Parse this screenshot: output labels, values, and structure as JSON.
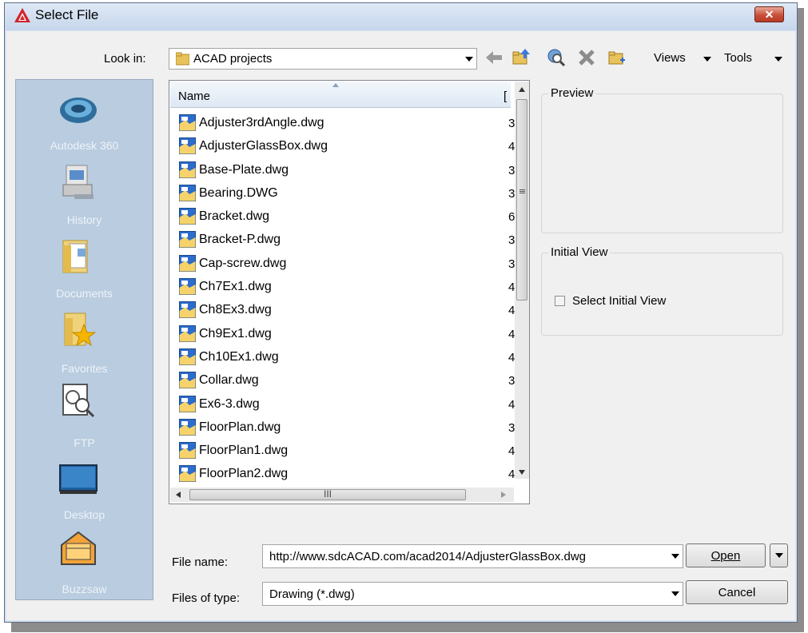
{
  "window": {
    "title": "Select File",
    "close_label": "✕"
  },
  "toolbar": {
    "look_in_label": "Look in:",
    "look_in_value": "ACAD projects",
    "views_label": "Views",
    "tools_label": "Tools"
  },
  "places": [
    {
      "label": "Autodesk 360",
      "icon": "autodesk-360-icon"
    },
    {
      "label": "History",
      "icon": "history-icon"
    },
    {
      "label": "Documents",
      "icon": "documents-icon"
    },
    {
      "label": "Favorites",
      "icon": "favorites-icon"
    },
    {
      "label": "FTP",
      "icon": "ftp-icon"
    },
    {
      "label": "Desktop",
      "icon": "desktop-icon"
    },
    {
      "label": "Buzzsaw",
      "icon": "buzzsaw-icon"
    }
  ],
  "file_list": {
    "column_name": "Name",
    "column_second": "[",
    "hscroll_grip": "III",
    "files": [
      {
        "name": "Adjuster3rdAngle.dwg",
        "partial": "3"
      },
      {
        "name": "AdjusterGlassBox.dwg",
        "partial": "4"
      },
      {
        "name": "Base-Plate.dwg",
        "partial": "3"
      },
      {
        "name": "Bearing.DWG",
        "partial": "3"
      },
      {
        "name": "Bracket.dwg",
        "partial": "6"
      },
      {
        "name": "Bracket-P.dwg",
        "partial": "3"
      },
      {
        "name": "Cap-screw.dwg",
        "partial": "3"
      },
      {
        "name": "Ch7Ex1.dwg",
        "partial": "4"
      },
      {
        "name": "Ch8Ex3.dwg",
        "partial": "4"
      },
      {
        "name": "Ch9Ex1.dwg",
        "partial": "4"
      },
      {
        "name": "Ch10Ex1.dwg",
        "partial": "4"
      },
      {
        "name": "Collar.dwg",
        "partial": "3"
      },
      {
        "name": "Ex6-3.dwg",
        "partial": "4"
      },
      {
        "name": "FloorPlan.dwg",
        "partial": "3"
      },
      {
        "name": "FloorPlan1.dwg",
        "partial": "4"
      },
      {
        "name": "FloorPlan2.dwg",
        "partial": "4"
      }
    ]
  },
  "preview": {
    "title": "Preview"
  },
  "initial_view": {
    "title": "Initial View",
    "checkbox_label": "Select Initial View",
    "checked": false
  },
  "file_name": {
    "label": "File name:",
    "value": "http://www.sdcACAD.com/acad2014/AdjusterGlassBox.dwg"
  },
  "file_type": {
    "label": "Files of type:",
    "value": "Drawing (*.dwg)"
  },
  "buttons": {
    "open": "Open",
    "cancel": "Cancel"
  },
  "colors": {
    "places_bg": "#b9cce0",
    "title_bar": "#d3e0f1",
    "close_button": "#c8503a"
  }
}
